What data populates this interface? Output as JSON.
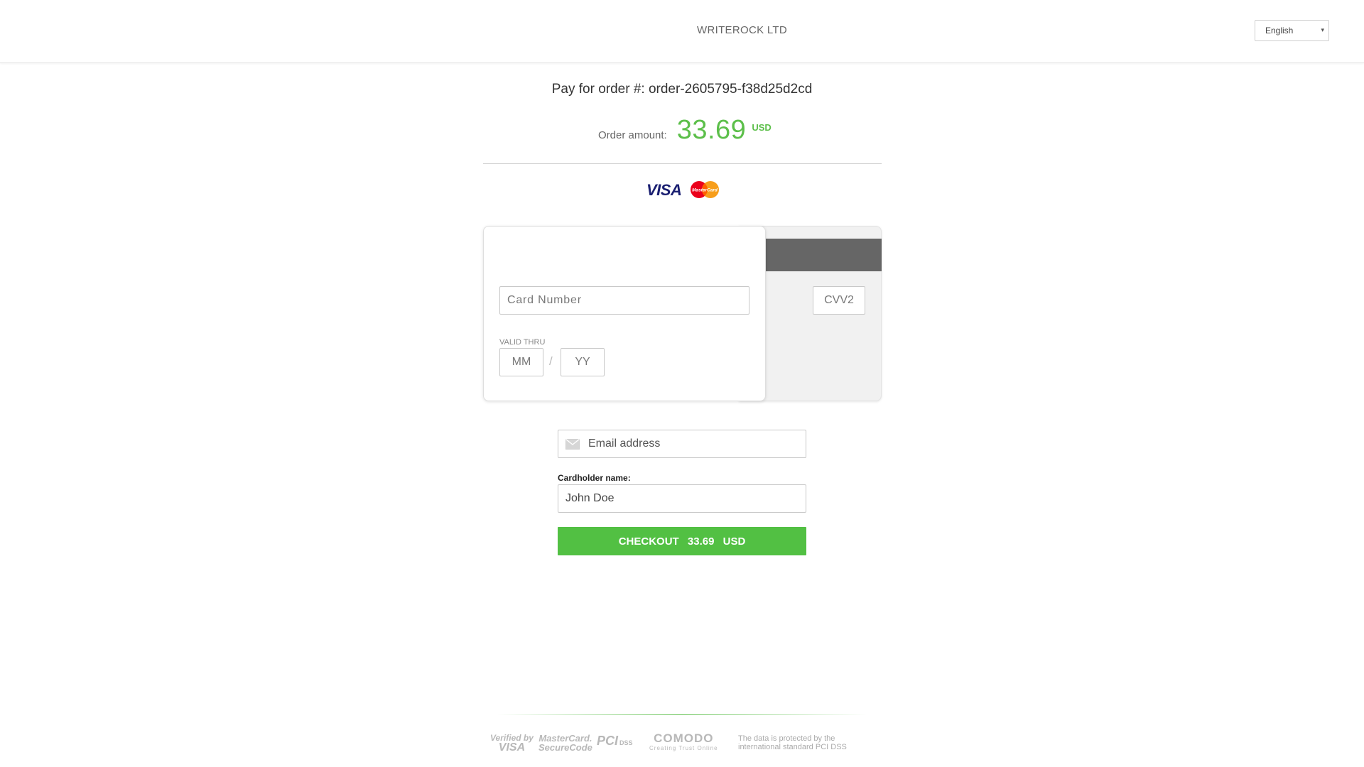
{
  "header": {
    "merchant_name": "WRITEROCK LTD",
    "language": {
      "selected": "English",
      "arrow": "▾"
    }
  },
  "order": {
    "title": "Pay for order #: order-2605795-f38d25d2cd",
    "amount_label": "Order amount:",
    "amount": "33.69",
    "currency": "USD"
  },
  "brands": {
    "visa": "VISA",
    "mastercard": "MasterCard"
  },
  "card": {
    "number_placeholder": "Card Number",
    "valid_thru_label": "VALID THRU",
    "month_placeholder": "MM",
    "separator": "/",
    "year_placeholder": "YY",
    "cvv_placeholder": "CVV2"
  },
  "form": {
    "email_placeholder": "Email address",
    "cardholder_label": "Cardholder name:",
    "cardholder_value": "John Doe",
    "checkout_label": "CHECKOUT",
    "checkout_amount": "33.69",
    "checkout_currency": "USD"
  },
  "footer": {
    "seals": {
      "visa_top": "Verified by",
      "visa_bottom": "VISA",
      "mc_top": "MasterCard.",
      "mc_bottom": "SecureCode",
      "pci": "PCI",
      "pci_dss": "DSS",
      "comodo": "COMODO",
      "comodo_tagline": "Creating Trust Online"
    },
    "note": "The data is protected by the international standard PCI DSS"
  },
  "colors": {
    "accent_green": "#5cbf4a",
    "button_green": "#52c043",
    "magstripe": "#666666"
  }
}
